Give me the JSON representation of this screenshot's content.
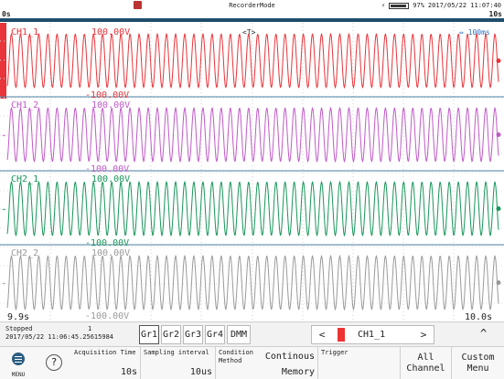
{
  "status": {
    "mode_title": "RecorderMode",
    "battery": "97%",
    "datetime": "2017/05/22 11:07:40"
  },
  "time_bar": {
    "start": "0s",
    "end": "10s"
  },
  "plot": {
    "marker": "<T>",
    "time_per_div": "⇔ 100ms",
    "left_time": "9.9s",
    "right_time": "10.0s",
    "channels": [
      {
        "name": "CH1_1",
        "upper": "100.00V",
        "lower": "-100.00V",
        "color": "#e8343a"
      },
      {
        "name": "CH1_2",
        "upper": "100.00V",
        "lower": "-100.00V",
        "color": "#c05ac8"
      },
      {
        "name": "CH2_1",
        "upper": "100.00V",
        "lower": "-100.00V",
        "color": "#18965a"
      },
      {
        "name": "CH2_2",
        "upper": "100.00V",
        "lower": "-100.00V",
        "color": "#9a9a9a"
      }
    ]
  },
  "info": {
    "state": "Stopped",
    "timestamp": "2017/05/22 11:06:45.25615984",
    "count": "1",
    "groups": [
      "Gr1",
      "Gr2",
      "Gr3",
      "Gr4",
      "DMM"
    ],
    "active_group": "Gr1",
    "selected_channel": "CH1_1",
    "prev": "<",
    "next": ">",
    "up": "^"
  },
  "softkeys": {
    "menu": "MENU",
    "help": "?",
    "acq_label": "Acquisition Time",
    "acq_value": "10s",
    "samp_label": "Sampling interval",
    "samp_value": "10us",
    "cond_label": "Condition",
    "method_label": "Method",
    "cond_value_1": "Continous",
    "cond_value_2": "Memory",
    "trigger_label": "Trigger",
    "all_1": "All",
    "all_2": "Channel",
    "custom_1": "Custom",
    "custom_2": "Menu"
  }
}
